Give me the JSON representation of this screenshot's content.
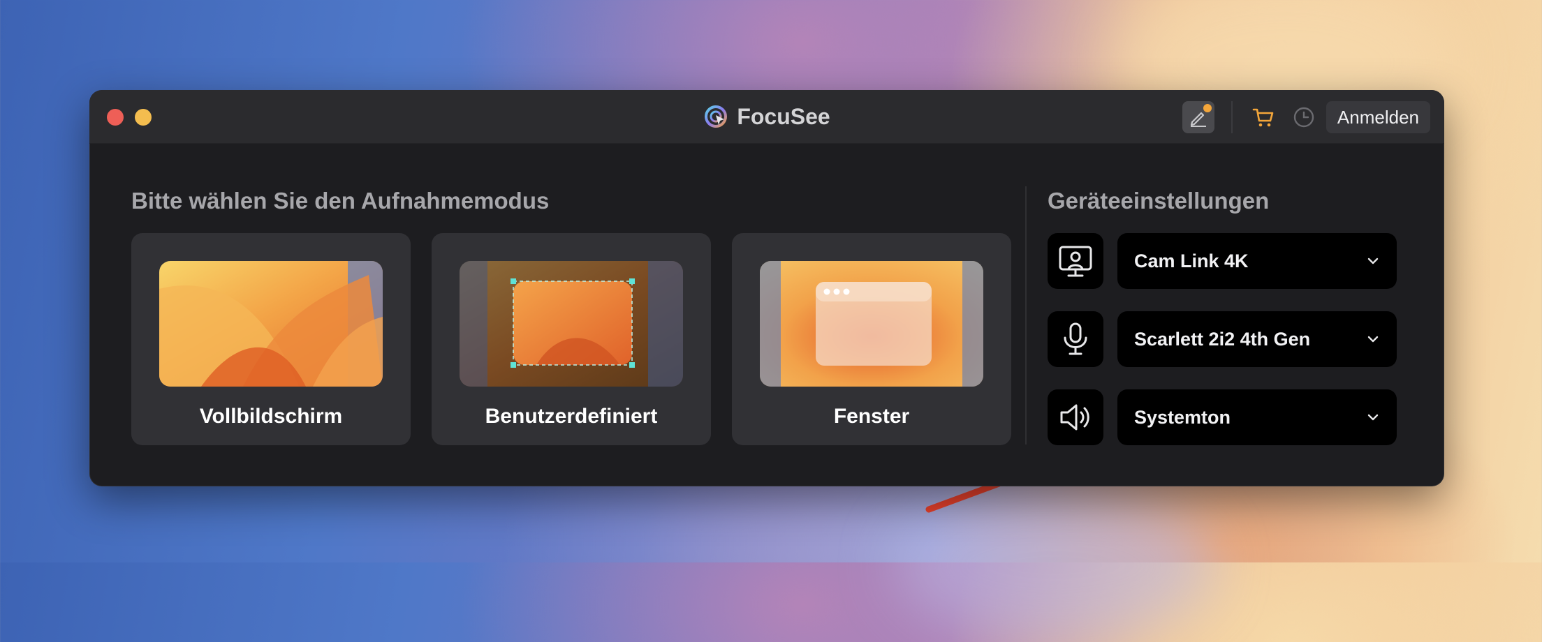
{
  "window": {
    "app_title": "FocuSee",
    "login_label": "Anmelden"
  },
  "icons": {
    "close": "close-dot",
    "minimize": "minimize-dot",
    "edit": "pen-icon",
    "cart": "cart-icon",
    "history": "clock-icon"
  },
  "colors": {
    "accent_orange": "#f4a63a",
    "window_bg": "#1d1d20",
    "card_bg": "#313135",
    "select_bg": "#000000",
    "arrow_red": "#e8412c"
  },
  "recording_mode": {
    "title": "Bitte wählen Sie den Aufnahmemodus",
    "modes": [
      {
        "label": "Vollbildschirm"
      },
      {
        "label": "Benutzerdefiniert"
      },
      {
        "label": "Fenster"
      }
    ]
  },
  "device_settings": {
    "title": "Geräteeinstellungen",
    "camera": {
      "icon": "camera-icon",
      "value": "Cam Link 4K"
    },
    "microphone": {
      "icon": "microphone-icon",
      "value": "Scarlett 2i2 4th Gen"
    },
    "speaker": {
      "icon": "speaker-icon",
      "value": "Systemton"
    }
  }
}
